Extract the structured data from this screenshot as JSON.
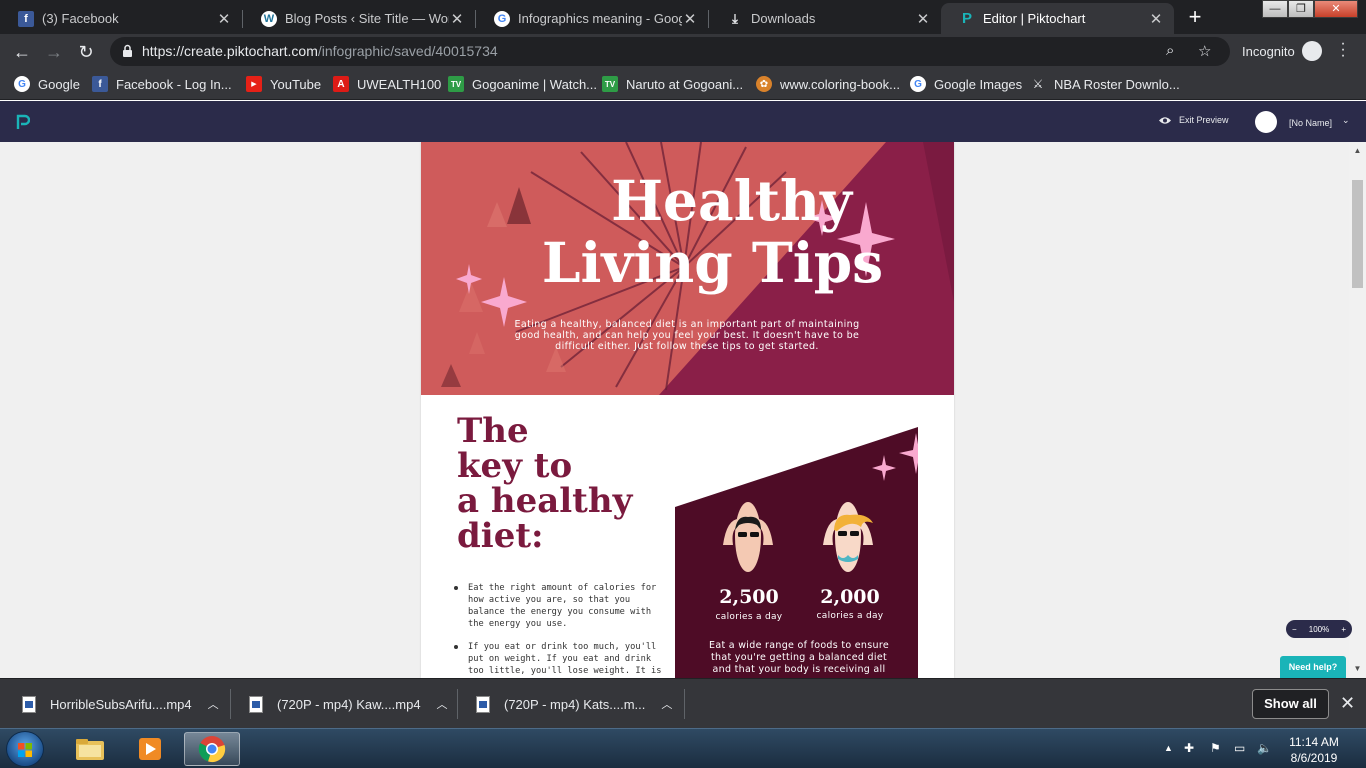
{
  "browser": {
    "tabs": [
      {
        "label": "(3) Facebook",
        "icon": "facebook-icon",
        "color": "#3b5998"
      },
      {
        "label": "Blog Posts ‹ Site Title — WordPr",
        "icon": "wordpress-icon",
        "color": "#21759b"
      },
      {
        "label": "Infographics meaning - Google",
        "icon": "google-icon",
        "color": "#4285f4"
      },
      {
        "label": "Downloads",
        "icon": "download-icon",
        "color": "#e8eaed"
      },
      {
        "label": "Editor | Piktochart",
        "icon": "piktochart-icon",
        "color": "#1ab4b8"
      }
    ],
    "url_host": "https://create.piktochart.com",
    "url_path": "/infographic/saved/40015734",
    "incognito_label": "Incognito",
    "bookmarks": [
      {
        "label": "Google",
        "icon": "google-icon"
      },
      {
        "label": "Facebook - Log In...",
        "icon": "facebook-icon"
      },
      {
        "label": "YouTube",
        "icon": "youtube-icon"
      },
      {
        "label": "UWEALTH100",
        "icon": "angular-icon"
      },
      {
        "label": "Gogoanime | Watch...",
        "icon": "tv-icon"
      },
      {
        "label": "Naruto at Gogoani...",
        "icon": "tv-icon"
      },
      {
        "label": "www.coloring-book...",
        "icon": "coloring-icon"
      },
      {
        "label": "Google Images",
        "icon": "google-icon"
      },
      {
        "label": "NBA Roster Downlo...",
        "icon": "nba-icon"
      }
    ]
  },
  "app": {
    "exit_preview": "Exit Preview",
    "user_name": "[No Name]",
    "zoom_level": "100%",
    "help_label": "Need help?"
  },
  "infographic": {
    "title_line1": "Healthy",
    "title_line2": "Living Tips",
    "description": "Eating a healthy, balanced diet is an important part of maintaining good health, and can help you feel your best. It doesn't have to be difficult either. Just follow these tips to get started.",
    "section_title": [
      "The",
      "key to",
      "a healthy",
      "diet:"
    ],
    "tips": [
      "Eat the right amount of calories for how active you are, so that you balance the energy you consume with the energy you use.",
      "If you eat or drink too much, you'll put on weight. If you eat and drink too little, you'll lose weight. It is"
    ],
    "male_calories": "2,500",
    "female_calories": "2,000",
    "calories_label": "calories a day",
    "panel_text": "Eat a wide range of foods to ensure that you're getting a balanced diet and that your body is receiving all"
  },
  "downloads": [
    {
      "name": "HorribleSubsArifu....mp4"
    },
    {
      "name": "(720P - mp4) Kaw....mp4"
    },
    {
      "name": "(720P - mp4) Kats....m..."
    }
  ],
  "downloads_show_all": "Show all",
  "taskbar": {
    "time": "11:14 AM",
    "date": "8/6/2019"
  },
  "colors": {
    "hero_coral": "#cf5b5b",
    "hero_crimson": "#8a1f48",
    "sparkle_pink": "#f9a9cf",
    "maroon_text": "#7a1a3e",
    "panel_maroon": "#4e0c26"
  }
}
